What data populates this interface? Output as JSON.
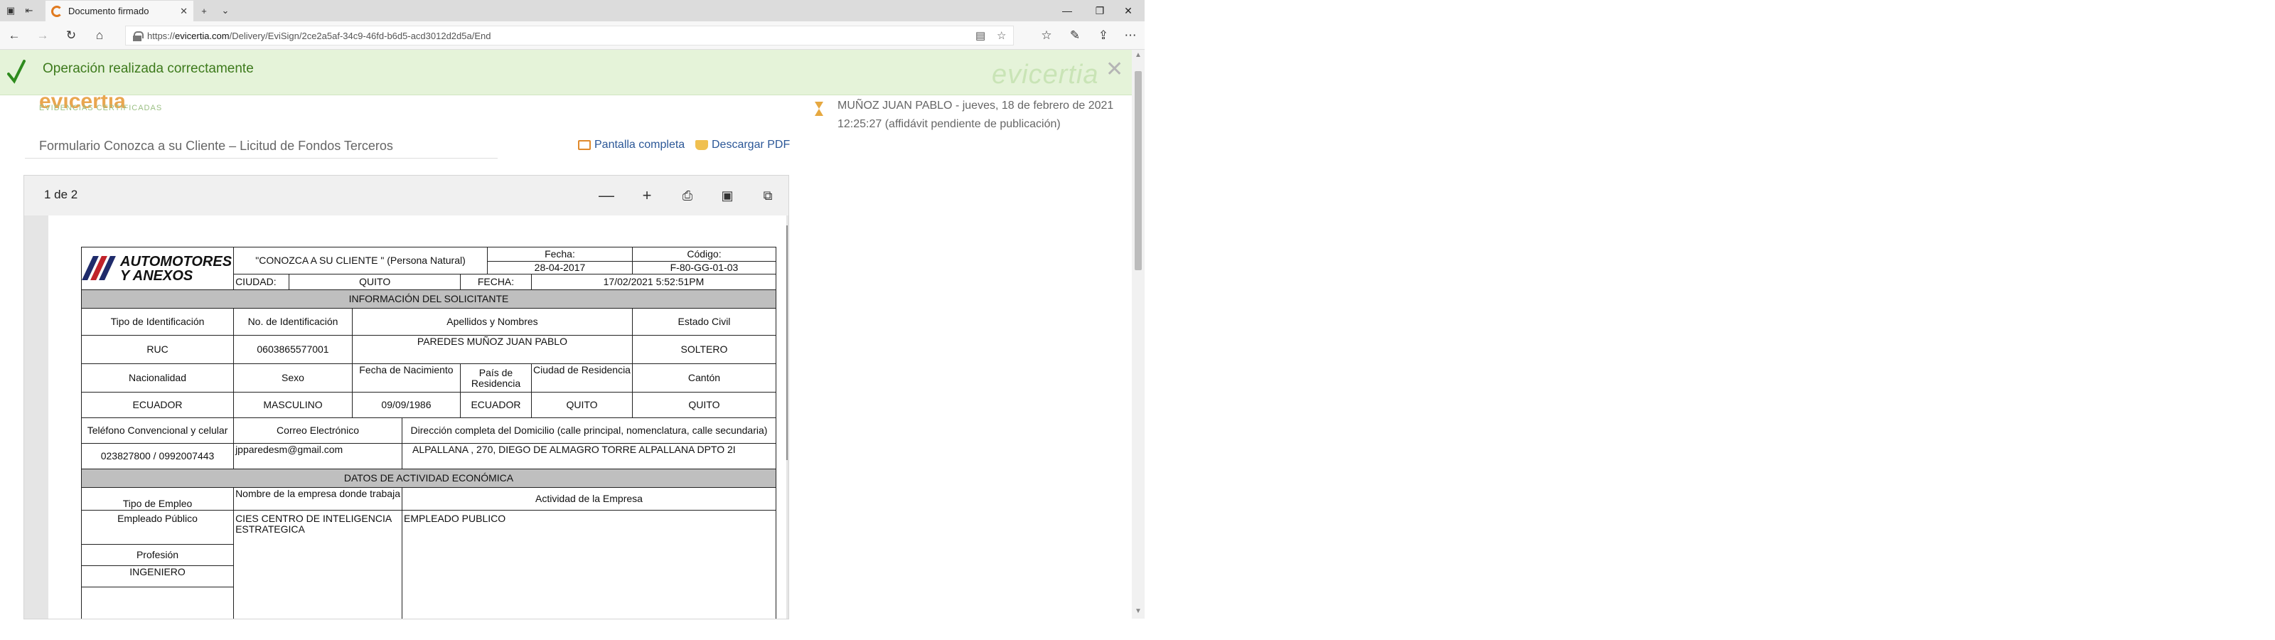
{
  "browser": {
    "tab_title": "Documento firmado",
    "url_prefix": "https://",
    "url_domain": "evicertia.com",
    "url_path": "/Delivery/EviSign/2ce2a5af-34c9-46fd-b6d5-acd3012d2d5a/End"
  },
  "banner": {
    "message": "Operación realizada correctamente",
    "watermark": "evicertia"
  },
  "page": {
    "logo_sub": "EVIDENCIAS CERTIFICADAS",
    "doc_title": "Formulario Conozca a su Cliente – Licitud de Fondos Terceros",
    "full_screen": "Pantalla completa",
    "download": "Descargar PDF",
    "notice": "MUÑOZ JUAN PABLO - jueves, 18 de febrero de 2021 12:25:27 (affidávit pendiente de publicación)"
  },
  "viewer": {
    "page_indicator": "1 de 2"
  },
  "form": {
    "logo_line1": "AUTOMOTORES",
    "logo_line2": "Y ANEXOS",
    "header_title": "\"CONOZCA A SU CLIENTE \" (Persona Natural)",
    "fecha_label": "Fecha:",
    "fecha_value": "28-04-2017",
    "codigo_label": "Código:",
    "codigo_value": "F-80-GG-01-03",
    "ciudad_label": "CIUDAD:",
    "ciudad_value": "QUITO",
    "fecha2_label": "FECHA:",
    "fecha2_value": "17/02/2021   5:52:51PM",
    "sec_solicitante": "INFORMACIÓN DEL SOLICITANTE",
    "h_tipo_id": "Tipo de Identificación",
    "h_no_id": "No. de Identificación",
    "h_nombres": "Apellidos y Nombres",
    "h_estado": "Estado Civil",
    "v_tipo_id": "RUC",
    "v_no_id": "0603865577001",
    "v_nombres": "PAREDES MUÑOZ JUAN PABLO",
    "v_estado": "SOLTERO",
    "h_nac": "Nacionalidad",
    "h_sexo": "Sexo",
    "h_fnac": "Fecha de Nacimiento",
    "h_pais": "País de Residencia",
    "h_ciudad_res": "Ciudad de Residencia",
    "h_canton": "Cantón",
    "v_nac": "ECUADOR",
    "v_sexo": "MASCULINO",
    "v_fnac": "09/09/1986",
    "v_pais": "ECUADOR",
    "v_ciudad_res": "QUITO",
    "v_canton": "QUITO",
    "h_tel": "Teléfono Convencional y celular",
    "h_correo": "Correo Electrónico",
    "h_dir": "Dirección completa del Domicilio (calle principal, nomenclatura, calle secundaria)",
    "v_tel": "023827800 / 0992007443",
    "v_correo": "jpparedesm@gmail.com",
    "v_dir": "ALPALLANA , 270, DIEGO DE ALMAGRO TORRE ALPALLANA DPTO 2I",
    "sec_actividad": "DATOS DE ACTIVIDAD ECONÓMICA",
    "h_tipo_empleo": "Tipo de Empleo",
    "h_empresa": "Nombre de la empresa donde trabaja",
    "h_actividad": "Actividad de la Empresa",
    "v_tipo_empleo": "Empleado Público",
    "v_empresa": "CIES CENTRO DE INTELIGENCIA ESTRATEGICA",
    "v_actividad": "EMPLEADO PUBLICO",
    "h_profesion": "Profesión",
    "v_profesion": "INGENIERO"
  },
  "colors": {
    "banner_bg": "#e5f3d9",
    "banner_text": "#3d7a1c",
    "link": "#2b5797",
    "accent_orange": "#e07a1f"
  }
}
